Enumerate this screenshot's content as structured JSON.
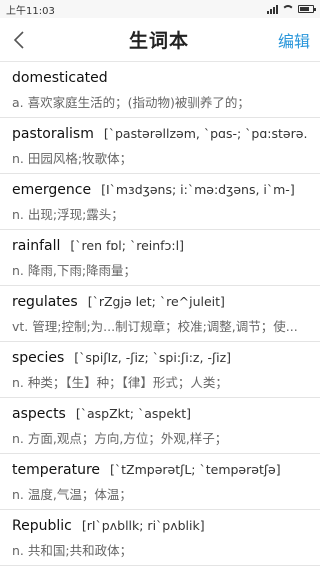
{
  "status": {
    "time": "上午11:03"
  },
  "header": {
    "title": "生词本",
    "edit_label": "编辑",
    "back_icon": "chevron-left-icon"
  },
  "words": [
    {
      "word": "domesticated",
      "phonetic": "",
      "definition": "a. 喜欢家庭生活的；(指动物)被驯养了的；"
    },
    {
      "word": "pastoralism",
      "phonetic": "[`pastərəllzəm, `pɑs-; `pɑ:stərə.",
      "definition": "n. 田园风格;牧歌体；"
    },
    {
      "word": "emergence",
      "phonetic": "[I`mɜdʒəns; i:`mə:dʒəns, i`m-]",
      "definition": "n. 出现;浮现;露头；"
    },
    {
      "word": "rainfall",
      "phonetic": "[`ren fɒl; `reinfɔ:l]",
      "definition": "n. 降雨,下雨;降雨量；"
    },
    {
      "word": "regulates",
      "phonetic": "[`rZgjə let; `re^juleit]",
      "definition": "vt. 管理;控制;为...制订规章；校准;调整,调节；使..."
    },
    {
      "word": "species",
      "phonetic": "[`spiʃIz, -ʃiz; `spi:ʃi:z, -ʃiz]",
      "definition": "n. 种类；【生】种；【律】形式；人类；"
    },
    {
      "word": "aspects",
      "phonetic": "[`aspZkt; `aspekt]",
      "definition": "n. 方面,观点；方向,方位；外观,样子；"
    },
    {
      "word": "temperature",
      "phonetic": "[`tZmpərətʃL; `tempərətʃə]",
      "definition": "n. 温度,气温；体温；"
    },
    {
      "word": "Republic",
      "phonetic": "[rI`pʌbllk; ri`pʌblik]",
      "definition": "n. 共和国;共和政体；"
    }
  ]
}
